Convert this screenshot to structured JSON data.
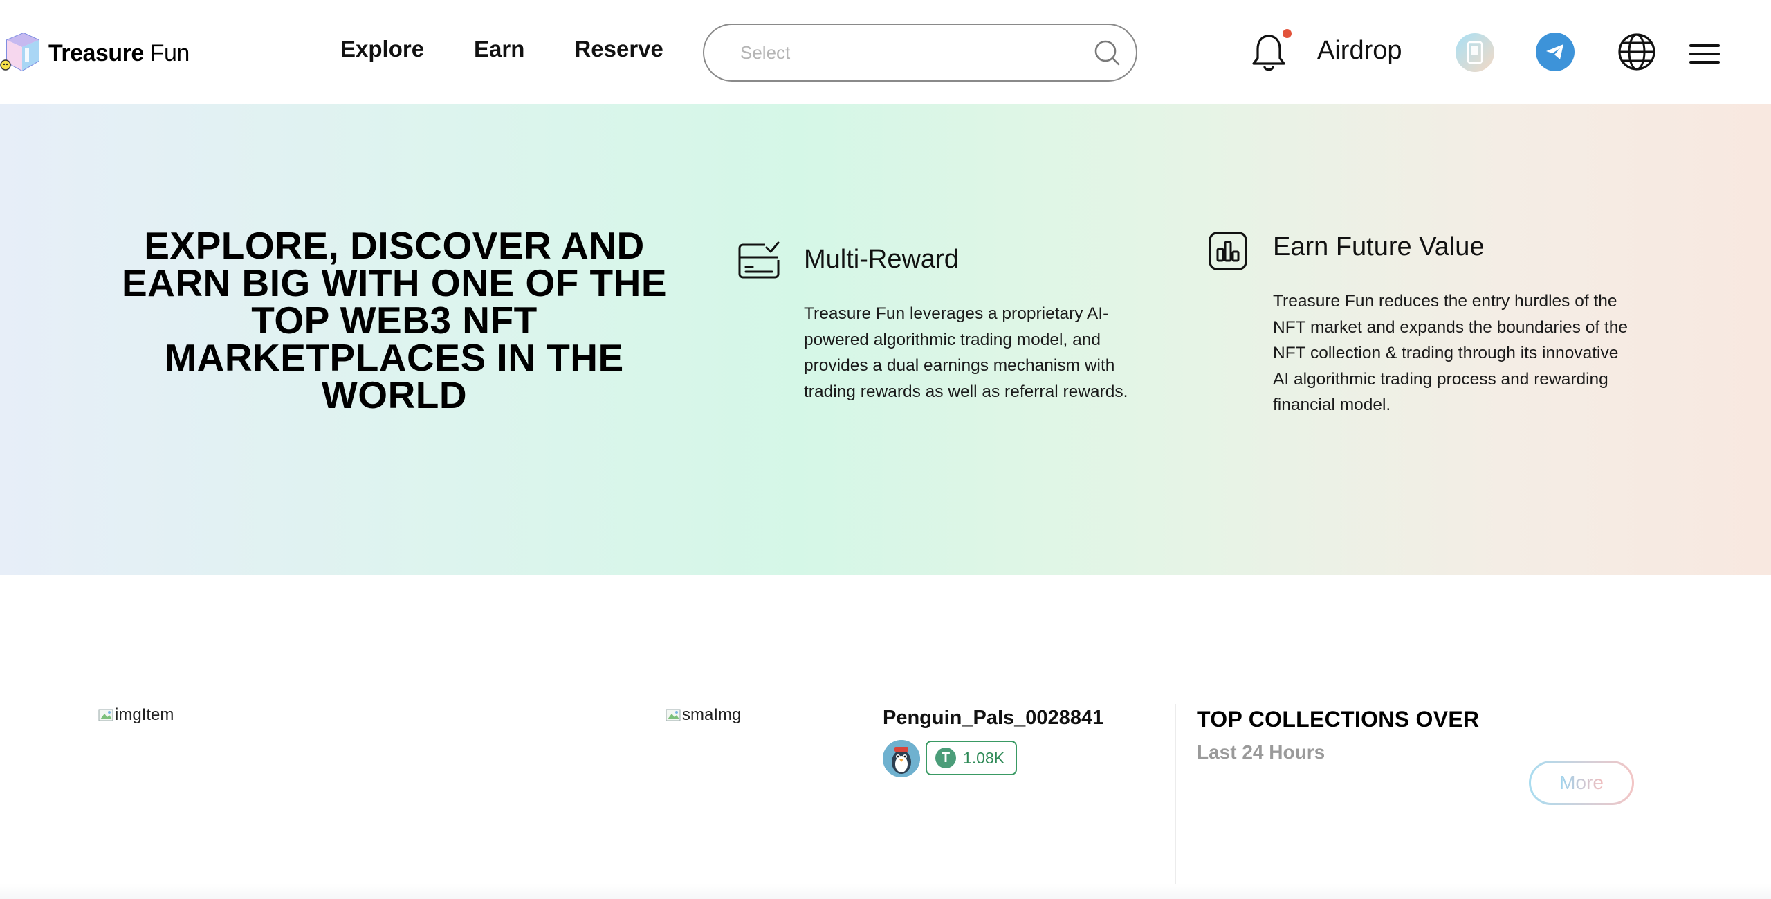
{
  "header": {
    "logo": {
      "brand_bold": "Treasure",
      "brand_light": "Fun"
    },
    "nav": [
      {
        "label": "Explore"
      },
      {
        "label": "Earn"
      },
      {
        "label": "Reserve"
      }
    ],
    "search": {
      "placeholder": "Select",
      "icon": "search-icon"
    },
    "notification": {
      "icon": "bell-icon",
      "has_unread": true,
      "dot_color": "#e2533b"
    },
    "airdrop_label": "Airdrop",
    "icons": [
      "app-icon",
      "telegram-icon",
      "globe-icon",
      "menu-icon"
    ]
  },
  "hero": {
    "title": "EXPLORE, DISCOVER AND EARN BIG WITH ONE OF THE TOP WEB3 NFT MARKETPLACES IN THE WORLD",
    "features": [
      {
        "icon": "card-check-icon",
        "title": "Multi-Reward",
        "text": "Treasure Fun leverages a proprietary AI-powered algorithmic trading model, and provides a dual earnings mechanism with trading rewards as well as referral rewards."
      },
      {
        "icon": "bar-chart-icon",
        "title": "Earn Future Value",
        "text": "Treasure Fun reduces the entry hurdles of the NFT market and expands the boundaries of the NFT collection & trading through its innovative AI algorithmic trading process and rewarding financial model."
      }
    ]
  },
  "featured": {
    "main_image_alt": "imgItem",
    "small_image_alt": "smaImg",
    "nft_name": "Penguin_Pals_0028841",
    "price": "1.08K",
    "currency_icon": "tether-icon",
    "price_color": "#2f8a57"
  },
  "top_collections": {
    "title": "TOP COLLECTIONS OVER",
    "subtitle": "Last 24 Hours",
    "more_label": "More"
  }
}
